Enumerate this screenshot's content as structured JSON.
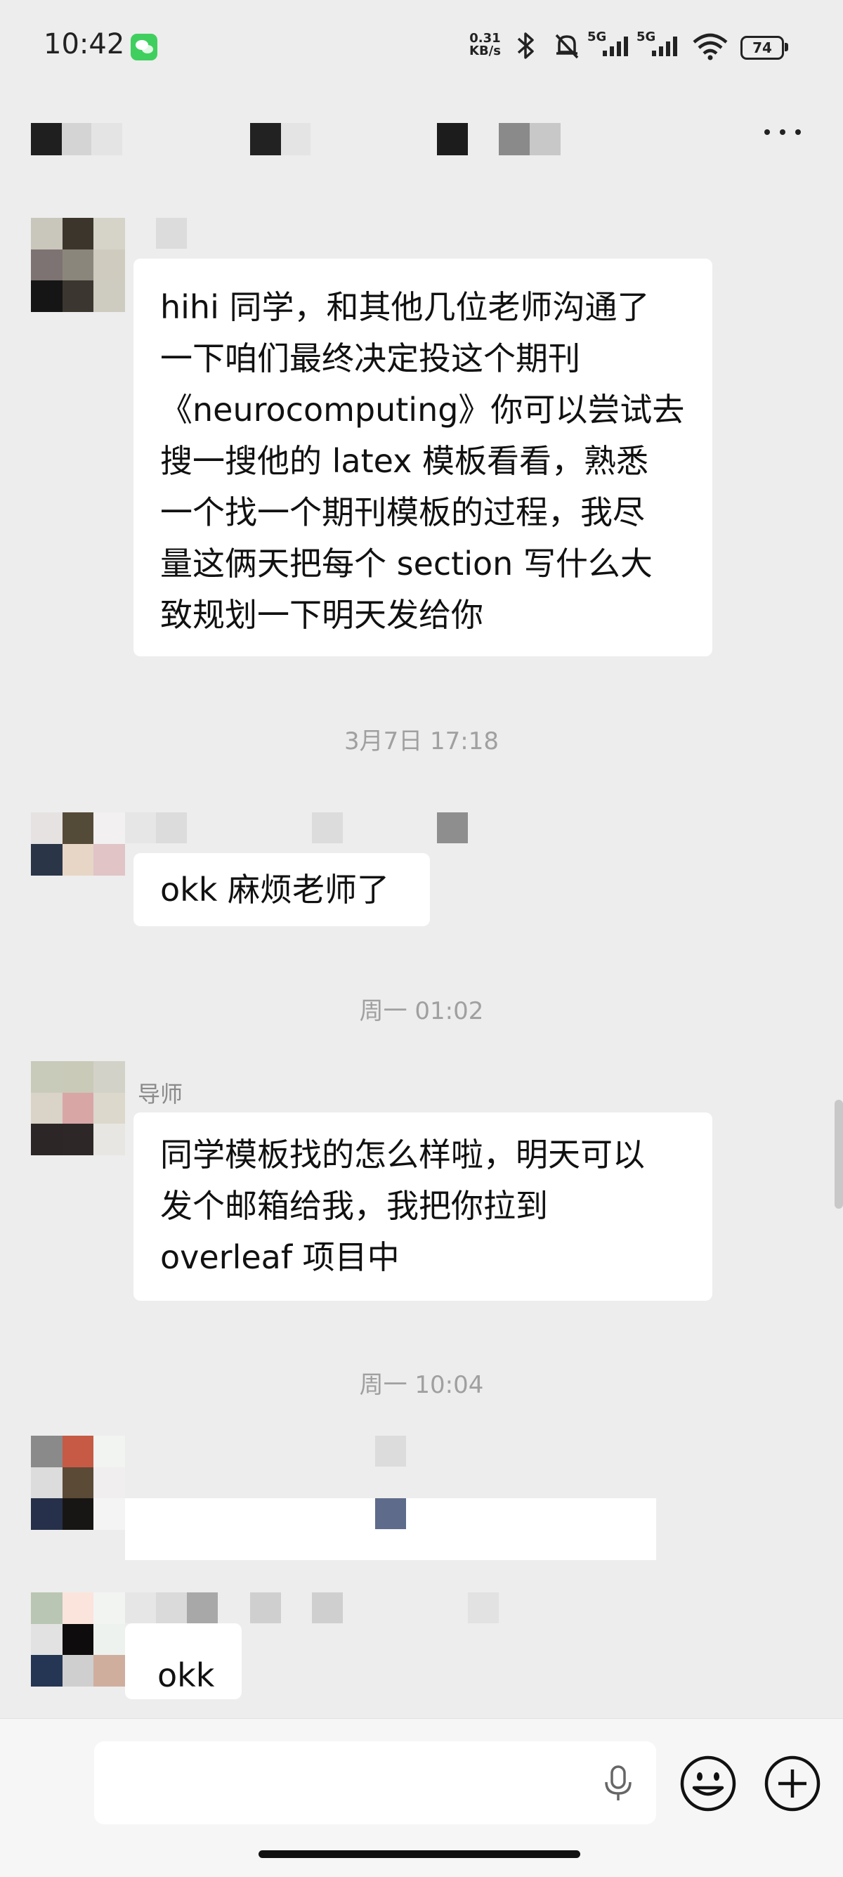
{
  "status_bar": {
    "time": "10:42",
    "net_speed_value": "0.31",
    "net_speed_unit": "KB/s",
    "network_1": "5G",
    "network_2": "5G",
    "battery": "74"
  },
  "chat": {
    "messages": [
      {
        "sender_label": "",
        "text": "hihi 同学，和其他几位老师沟通了\n一下咱们最终决定投这个期刊\n《neurocomputing》你可以尝试去\n搜一搜他的 latex 模板看看，熟悉\n一个找一个期刊模板的过程，我尽\n量这俩天把每个 section 写什么大\n致规划一下明天发给你"
      },
      {
        "timestamp": "3月7日 17:18"
      },
      {
        "sender_label": "",
        "text": "okk 麻烦老师了"
      },
      {
        "timestamp": "周一 01:02"
      },
      {
        "sender_label": "导师",
        "text": "同学模板找的怎么样啦，明天可以\n发个邮箱给我，我把你拉到\noverleaf 项目中"
      },
      {
        "timestamp": "周一 10:04"
      },
      {
        "sender_label": "",
        "text": ""
      },
      {
        "sender_label": "",
        "text": "okk"
      }
    ]
  },
  "input_bar": {
    "voice_icon": "microphone-icon",
    "emoji_icon": "smiley-icon",
    "plus_icon": "plus-icon"
  },
  "colors": {
    "background": "#ededed",
    "bubble": "#ffffff",
    "timestamp": "#a0a0a0",
    "wechat_green": "#3fcf5e"
  }
}
